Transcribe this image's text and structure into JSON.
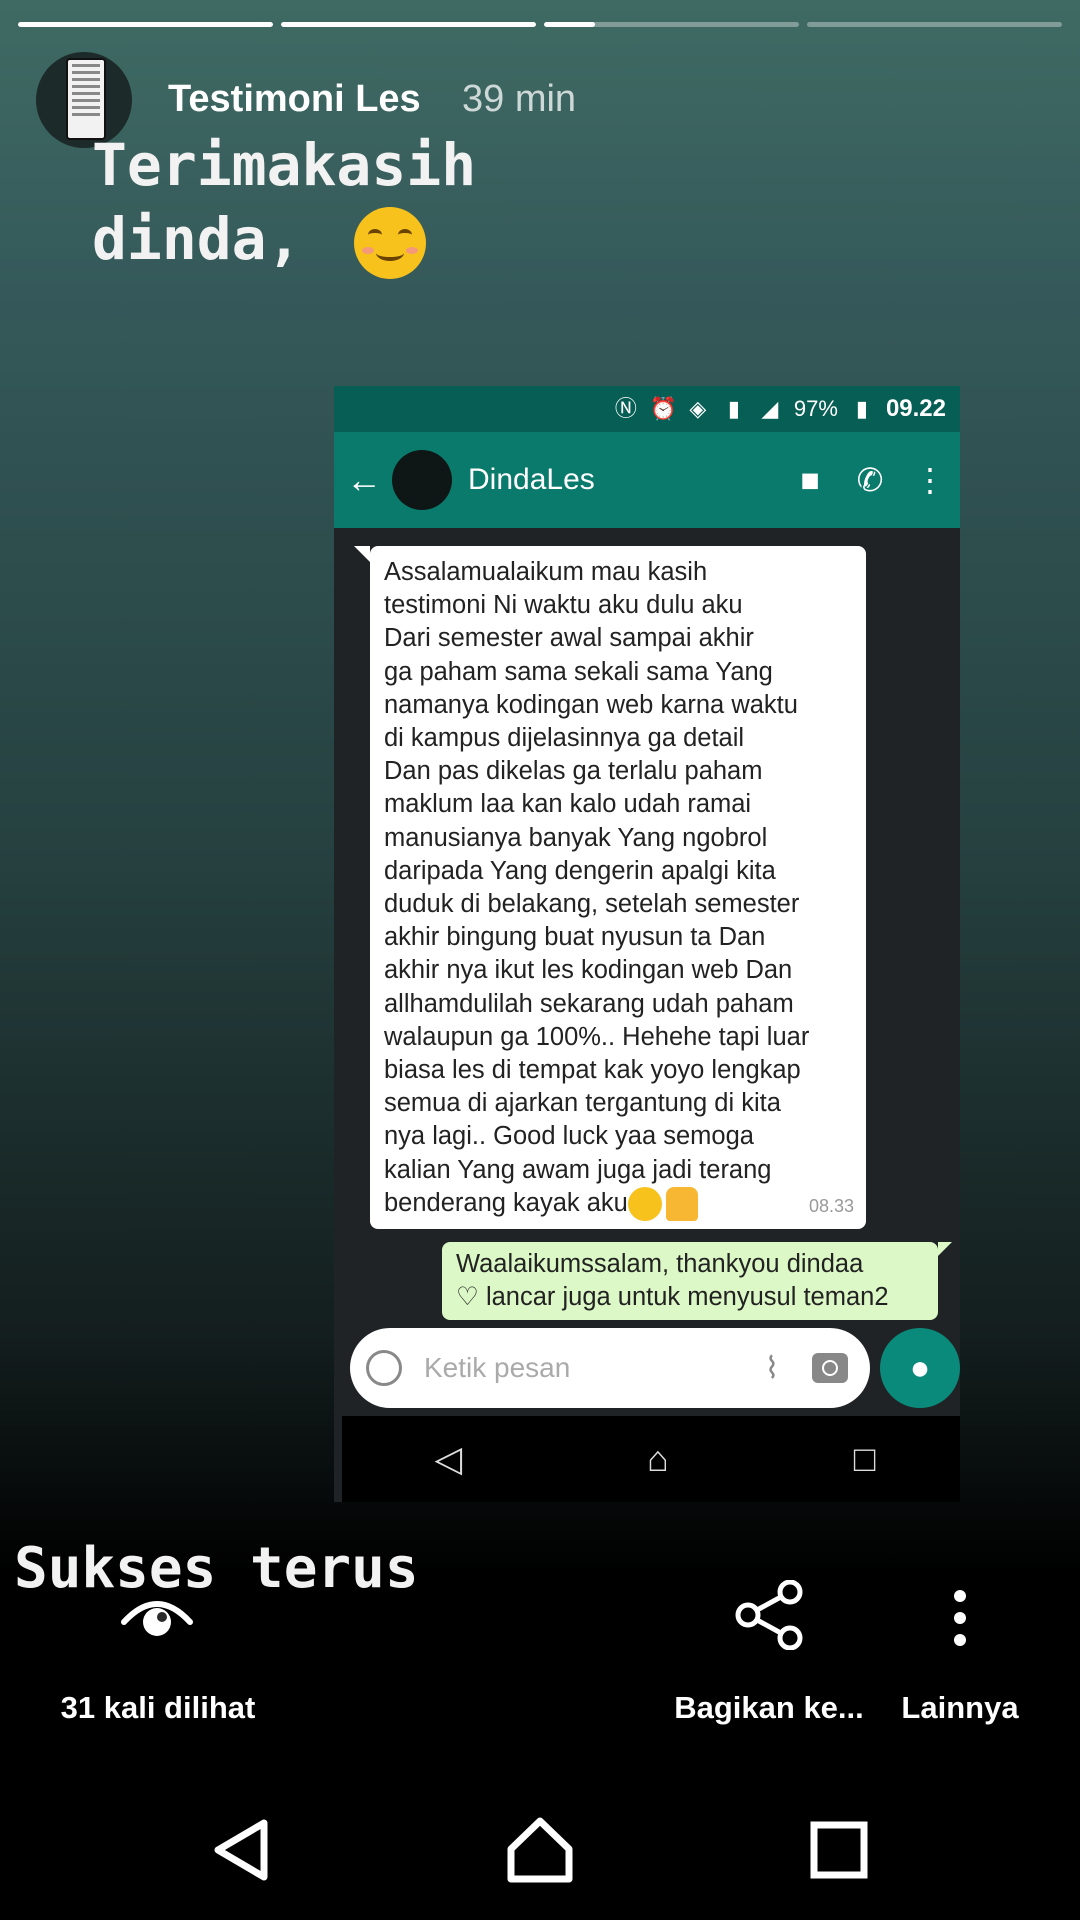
{
  "story": {
    "progress": [
      1.0,
      1.0,
      0.2,
      0.0
    ],
    "username": "Testimoni Les",
    "time": "39 min",
    "caption_top_line1": "Terimakasih",
    "caption_top_line2": "dinda,",
    "caption_bottom": "Sukses terus"
  },
  "screenshot": {
    "status": {
      "battery": "97%",
      "clock": "09.22"
    },
    "chat": {
      "contact": "DindaLes",
      "incoming": {
        "lines": [
          "Assalamualaikum mau kasih",
          "testimoni Ni waktu aku dulu aku",
          "Dari semester awal sampai akhir",
          "ga paham sama sekali sama Yang",
          "namanya kodingan web karna waktu",
          "di kampus dijelasinnya ga detail",
          "Dan pas dikelas ga terlalu paham",
          "maklum laa kan kalo udah ramai",
          "manusianya banyak Yang ngobrol",
          "daripada Yang dengerin apalgi kita",
          "duduk di belakang, setelah semester",
          "akhir bingung buat nyusun ta Dan",
          "akhir nya ikut les kodingan web Dan",
          "allhamdulilah sekarang udah paham",
          "walaupun ga 100%.. Hehehe tapi luar",
          "biasa les di tempat kak yoyo lengkap",
          "semua di ajarkan tergantung di kita",
          "nya lagi..  Good luck yaa semoga",
          "kalian Yang awam juga jadi terang",
          "benderang kayak aku"
        ],
        "time": "08.33"
      },
      "outgoing": {
        "line1": "Waalaikumssalam, thankyou dindaa",
        "line2": "♡ lancar juga untuk menyusul teman2"
      },
      "input_placeholder": "Ketik pesan"
    }
  },
  "actions": {
    "views": "31 kali dilihat",
    "share": "Bagikan ke...",
    "more": "Lainnya"
  },
  "colors": {
    "whatsapp_header": "#0a7a6c",
    "whatsapp_status": "#075e54",
    "outgoing_bubble": "#dcf8c6"
  }
}
